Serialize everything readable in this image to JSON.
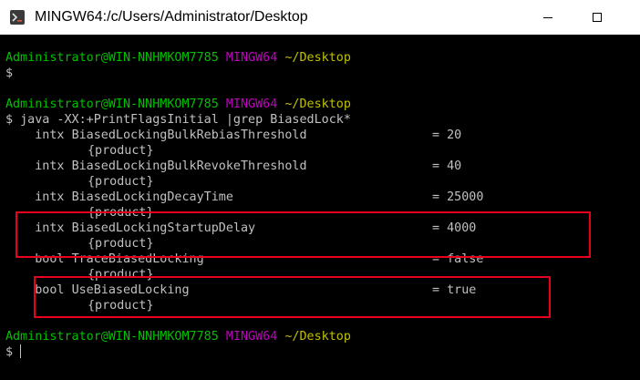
{
  "window": {
    "title": "MINGW64:/c/Users/Administrator/Desktop",
    "icon": "git-bash-icon",
    "minimize_icon": "minimize-icon",
    "maximize_icon": "maximize-icon"
  },
  "terminal": {
    "prompts": [
      {
        "user": "Administrator@WIN-NNHMKOM7785",
        "env": "MINGW64",
        "dir": "~/Desktop"
      },
      {
        "user": "Administrator@WIN-NNHMKOM7785",
        "env": "MINGW64",
        "dir": "~/Desktop"
      },
      {
        "user": "Administrator@WIN-NNHMKOM7785",
        "env": "MINGW64",
        "dir": "~/Desktop"
      }
    ],
    "dollar": "$",
    "command": "$ java -XX:+PrintFlagsInitial |grep BiasedLock*",
    "flags": [
      {
        "type": "intx",
        "name": "BiasedLockingBulkRebiasThreshold",
        "value": "= 20",
        "scope": "{product}"
      },
      {
        "type": "intx",
        "name": "BiasedLockingBulkRevokeThreshold",
        "value": "= 40",
        "scope": "{product}"
      },
      {
        "type": "intx",
        "name": "BiasedLockingDecayTime",
        "value": "= 25000",
        "scope": "{product}"
      },
      {
        "type": "intx",
        "name": "BiasedLockingStartupDelay",
        "value": "= 4000",
        "scope": "{product}"
      },
      {
        "type": "bool",
        "name": "TraceBiasedLocking",
        "value": "= false",
        "scope": "{product}"
      },
      {
        "type": "bool",
        "name": "UseBiasedLocking",
        "value": "= true",
        "scope": "{product}"
      }
    ]
  },
  "colors": {
    "prompt_user": "#00c000",
    "prompt_env": "#c000c0",
    "prompt_dir": "#c0c000",
    "text": "#c0c0c0",
    "highlight": "#e8001c"
  }
}
